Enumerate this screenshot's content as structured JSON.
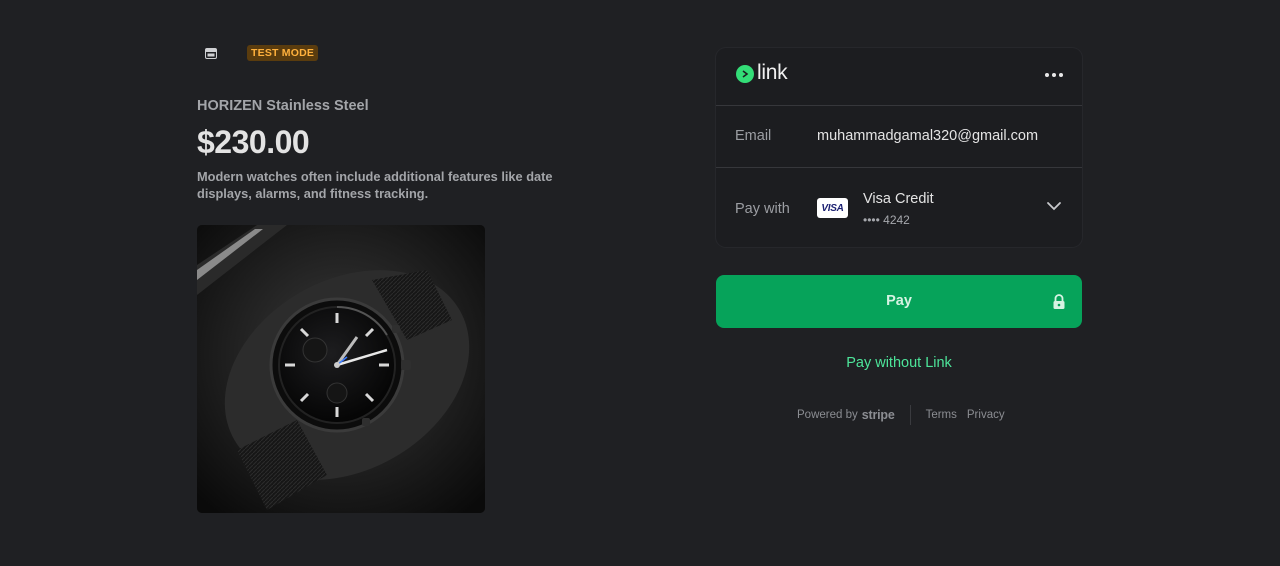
{
  "header": {
    "store_icon": "store-icon",
    "test_mode_badge": "TEST MODE"
  },
  "product": {
    "name": "HORIZEN Stainless Steel",
    "price": "$230.00",
    "description": "Modern watches often include additional features like date displays, alarms, and fitness tracking.",
    "image_alt": "Black chronograph wristwatch with mesh strap in a display box"
  },
  "link": {
    "logo_text": "link",
    "more_icon": "more-horizontal-icon",
    "email_label": "Email",
    "email_value": "muhammadgamal320@gmail.com",
    "pay_with_label": "Pay with",
    "card_brand": "VISA",
    "card_name": "Visa Credit",
    "card_last4": "•••• 4242",
    "chevron_icon": "chevron-down-icon"
  },
  "pay_button": {
    "label": "Pay",
    "icon": "lock-icon"
  },
  "pay_without_link": "Pay without Link",
  "footer": {
    "powered_by": "Powered by",
    "stripe": "stripe",
    "terms": "Terms",
    "privacy": "Privacy"
  },
  "colors": {
    "background": "#1f2023",
    "card_background": "#1c1d20",
    "pay_button": "#06a35a",
    "link_green": "#33dd77",
    "pay_without_link_text": "#4de59a",
    "test_badge_bg": "#5a3c0e",
    "test_badge_text": "#ffb13d"
  }
}
